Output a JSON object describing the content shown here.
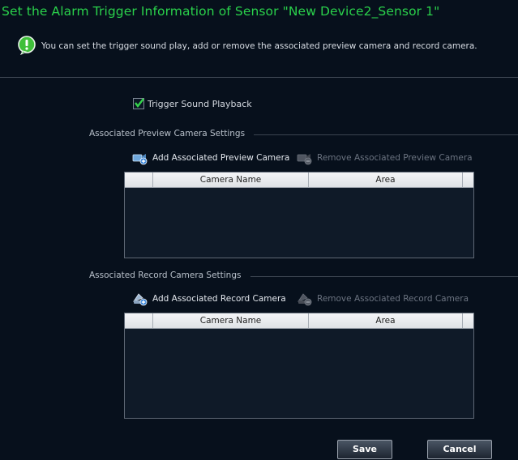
{
  "header": {
    "title": "Set the Alarm Trigger Information of Sensor \"New Device2_Sensor 1\"",
    "info": "You can set the trigger sound play, add or remove the associated preview camera and record camera."
  },
  "trigger_sound": {
    "label": "Trigger Sound Playback",
    "checked": true
  },
  "preview_section": {
    "title": "Associated Preview Camera Settings",
    "add_label": "Add Associated Preview Camera",
    "remove_label": "Remove Associated Preview Camera",
    "columns": [
      "",
      "Camera Name",
      "Area",
      ""
    ],
    "rows": []
  },
  "record_section": {
    "title": "Associated Record  Camera Settings",
    "add_label": "Add Associated Record  Camera",
    "remove_label": "Remove Associated Record  Camera",
    "columns": [
      "",
      "Camera Name",
      "Area",
      ""
    ],
    "rows": []
  },
  "buttons": {
    "save": "Save",
    "cancel": "Cancel"
  },
  "colors": {
    "title": "#2ad14b",
    "background": "#07101c"
  }
}
